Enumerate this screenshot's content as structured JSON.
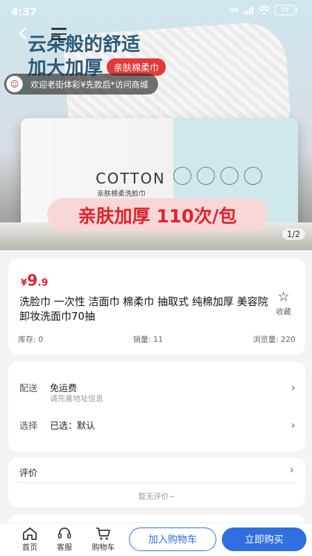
{
  "status_bar": {
    "time": "4:37",
    "network": "HD",
    "battery": "74"
  },
  "hero": {
    "headline_line1": "云朵般的舒适",
    "headline_line2": "加大加厚",
    "badge": "亲肤棉柔巾",
    "brand_text": "COTTON",
    "brand_subtext": "亲肤棉柔洗脸巾",
    "promo": "亲肤加厚 110次/包",
    "page_indicator": "1/2"
  },
  "welcome": {
    "text": "欢迎老街体彩¥先款后*访问商城"
  },
  "product": {
    "price_symbol": "¥",
    "price_main": "9",
    "price_decimal": ".9",
    "title": "洗脸巾 一次性 洁面巾 棉柔巾 抽取式 纯棉加厚 美容院卸妆洗面巾70抽",
    "favorite_label": "收藏",
    "stock": "库存: 0",
    "sales": "销量: 11",
    "views": "浏览量: 220"
  },
  "shipping": {
    "label": "配送",
    "value": "免运费",
    "subtext": "请完善地址信息"
  },
  "selection": {
    "label": "选择",
    "value": "已选：默认"
  },
  "reviews": {
    "title": "评价",
    "empty_text": "暂无评价~"
  },
  "bottom_bar": {
    "home_label": "首页",
    "service_label": "客服",
    "cart_label": "购物车",
    "add_to_cart": "加入购物车",
    "buy_now": "立即购买"
  },
  "colors": {
    "accent": "#2f6fe0",
    "price": "#e0242c"
  }
}
